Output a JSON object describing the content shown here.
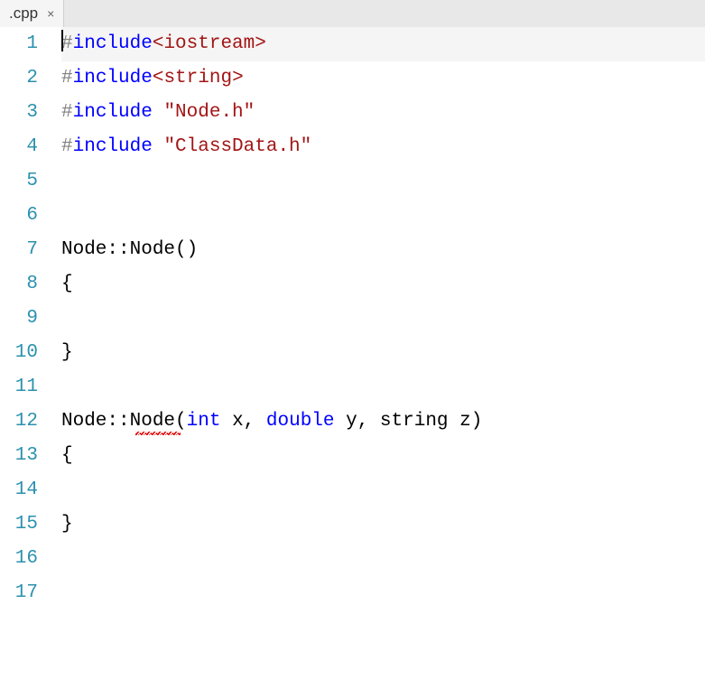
{
  "tab": {
    "filename": ".cpp",
    "close_glyph": "×"
  },
  "gutter": {
    "lines": [
      "1",
      "2",
      "3",
      "4",
      "5",
      "6",
      "7",
      "8",
      "9",
      "10",
      "11",
      "12",
      "13",
      "14",
      "15",
      "16",
      "17"
    ]
  },
  "code": {
    "line1": {
      "hash": "#",
      "kw": "include",
      "open": "<",
      "name": "iostream",
      "close": ">"
    },
    "line2": {
      "hash": "#",
      "kw": "include",
      "open": "<",
      "name": "string",
      "close": ">"
    },
    "line3": {
      "hash": "#",
      "kw": "include",
      "space": " ",
      "str": "\"Node.h\""
    },
    "line4": {
      "hash": "#",
      "kw": "include",
      "space": " ",
      "str": "\"ClassData.h\""
    },
    "line5": "",
    "line6": "",
    "line7": "Node::Node()",
    "line8": "{",
    "line9": "",
    "line10": "}",
    "line11": "",
    "line12": {
      "prefix": "Node::",
      "fn": "Node",
      "open": "(",
      "kw1": "int",
      "p1": " x, ",
      "kw2": "double",
      "p2": " y, string z)",
      "close": ""
    },
    "line13": "{",
    "line14": "",
    "line15": "}",
    "line16": "",
    "line17": ""
  }
}
